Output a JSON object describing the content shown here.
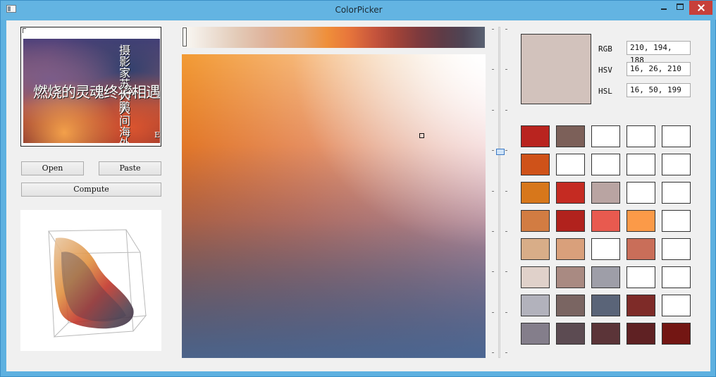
{
  "window": {
    "title": "ColorPicker"
  },
  "buttons": {
    "open": "Open",
    "paste": "Paste",
    "compute": "Compute"
  },
  "image_text": {
    "main": "燃烧的灵魂终将相遇",
    "vertical1": "摄影家苏大鹏",
    "x": "X",
    "vertical2": "人间海外五友",
    "small": "E"
  },
  "selected": {
    "color": "#d2c2bc",
    "rgb": "210, 194, 188",
    "hsv": "16, 26, 210",
    "hsl": "16, 50, 199"
  },
  "labels": {
    "rgb": "RGB",
    "hsv": "HSV",
    "hsl": "HSL"
  },
  "palette": [
    [
      "#b9241f",
      "#7c6059",
      "#ffffff",
      "#ffffff",
      "#ffffff"
    ],
    [
      "#cf5219",
      "#ffffff",
      "#ffffff",
      "#ffffff",
      "#ffffff"
    ],
    [
      "#d7771b",
      "#c52b22",
      "#b9a4a2",
      "#ffffff",
      "#ffffff"
    ],
    [
      "#d27c42",
      "#b1221d",
      "#e85a4f",
      "#fb9a48",
      "#ffffff"
    ],
    [
      "#d8ad88",
      "#d9a07b",
      "#ffffff",
      "#c96e59",
      "#ffffff"
    ],
    [
      "#e0d1ca",
      "#a98a82",
      "#9e9ea8",
      "#ffffff",
      "#ffffff"
    ],
    [
      "#b2b2bc",
      "#7a6562",
      "#5a6478",
      "#7e2b28",
      "#ffffff"
    ],
    [
      "#847e8b",
      "#5c4b52",
      "#5b3438",
      "#5f2123",
      "#731613"
    ]
  ]
}
